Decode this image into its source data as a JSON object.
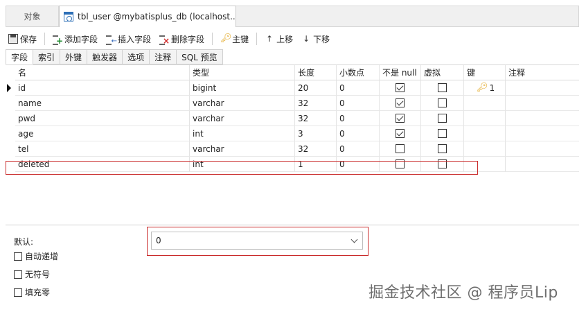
{
  "tabs": {
    "objects": "对象",
    "active": "tbl_user @mybatisplus_db (localhost..."
  },
  "toolbar": {
    "save": "保存",
    "add_field": "添加字段",
    "insert_field": "插入字段",
    "delete_field": "删除字段",
    "primary_key": "主键",
    "move_up": "上移",
    "move_down": "下移"
  },
  "subtabs": [
    "字段",
    "索引",
    "外键",
    "触发器",
    "选项",
    "注释",
    "SQL 预览"
  ],
  "grid": {
    "headers": [
      "名",
      "类型",
      "长度",
      "小数点",
      "不是 null",
      "虚拟",
      "键",
      "注释"
    ],
    "rows": [
      {
        "name": "id",
        "type": "bigint",
        "length": "20",
        "decimals": "0",
        "not_null": true,
        "virtual": false,
        "key": "1",
        "current": true
      },
      {
        "name": "name",
        "type": "varchar",
        "length": "32",
        "decimals": "0",
        "not_null": true,
        "virtual": false,
        "key": ""
      },
      {
        "name": "pwd",
        "type": "varchar",
        "length": "32",
        "decimals": "0",
        "not_null": true,
        "virtual": false,
        "key": ""
      },
      {
        "name": "age",
        "type": "int",
        "length": "3",
        "decimals": "0",
        "not_null": true,
        "virtual": false,
        "key": ""
      },
      {
        "name": "tel",
        "type": "varchar",
        "length": "32",
        "decimals": "0",
        "not_null": false,
        "virtual": false,
        "key": ""
      },
      {
        "name": "deleted",
        "type": "int",
        "length": "1",
        "decimals": "0",
        "not_null": false,
        "virtual": false,
        "key": ""
      }
    ]
  },
  "properties": {
    "default_label": "默认:",
    "default_value": "0",
    "auto_increment": "自动递增",
    "unsigned": "无符号",
    "zerofill": "填充零"
  },
  "watermark": "掘金技术社区 @ 程序员Lip"
}
